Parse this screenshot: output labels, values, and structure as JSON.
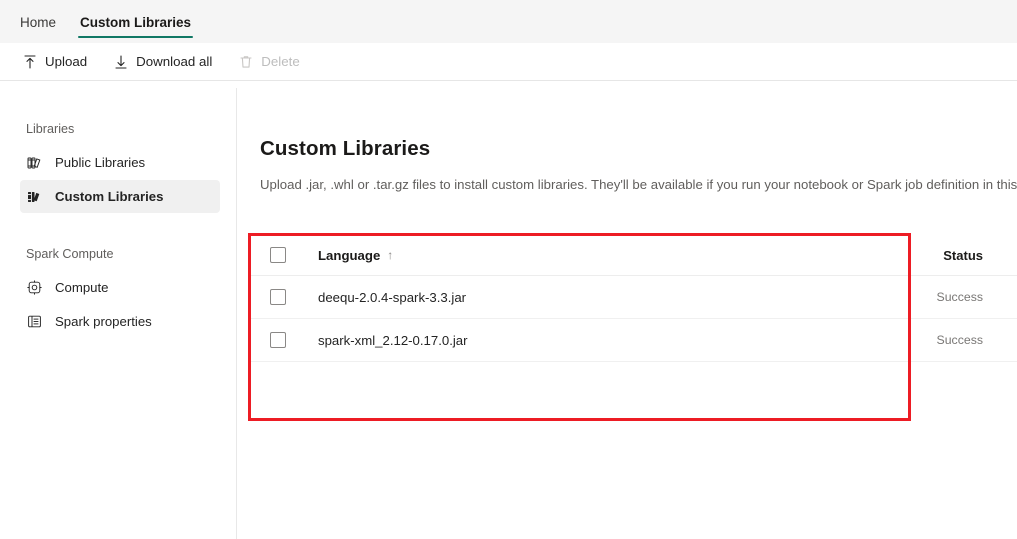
{
  "colors": {
    "accent": "#117865",
    "annotation": "#ed1c24"
  },
  "tabs": [
    {
      "label": "Home",
      "active": false
    },
    {
      "label": "Custom Libraries",
      "active": true
    }
  ],
  "toolbar": {
    "upload_label": "Upload",
    "download_all_label": "Download all",
    "delete_label": "Delete"
  },
  "sidebar": {
    "groups": [
      {
        "label": "Libraries",
        "items": [
          {
            "label": "Public Libraries",
            "icon": "books-outline-icon",
            "selected": false
          },
          {
            "label": "Custom Libraries",
            "icon": "books-filled-icon",
            "selected": true
          }
        ]
      },
      {
        "label": "Spark Compute",
        "items": [
          {
            "label": "Compute",
            "icon": "gear-chip-icon",
            "selected": false
          },
          {
            "label": "Spark properties",
            "icon": "list-properties-icon",
            "selected": false
          }
        ]
      }
    ]
  },
  "main": {
    "title": "Custom Libraries",
    "description": "Upload .jar, .whl or .tar.gz files to install custom libraries. They'll be available if you run your notebook or Spark job definition in this environment"
  },
  "table": {
    "columns": {
      "language": "Language",
      "sort_indicator": "↑",
      "status": "Status"
    },
    "rows": [
      {
        "language": "deequ-2.0.4-spark-3.3.jar",
        "status": "Success"
      },
      {
        "language": "spark-xml_2.12-0.17.0.jar",
        "status": "Success"
      }
    ]
  }
}
